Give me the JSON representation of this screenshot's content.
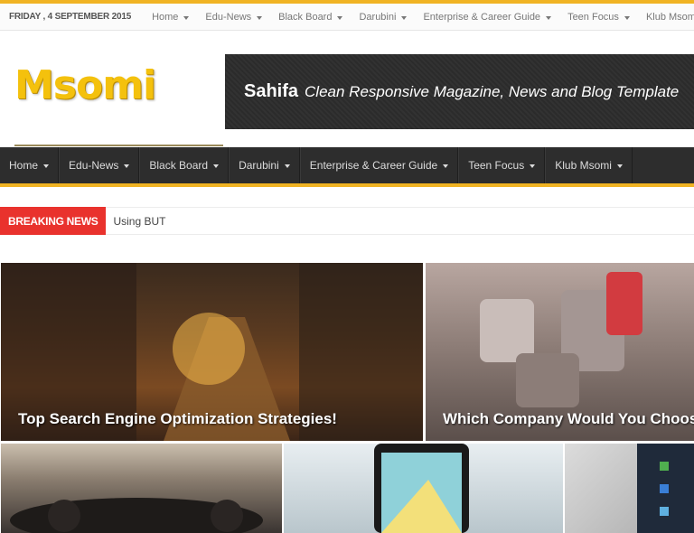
{
  "topbar": {
    "date": "FRIDAY , 4 SEPTEMBER 2015",
    "items": [
      "Home",
      "Edu-News",
      "Black Board",
      "Darubini",
      "Enterprise & Career Guide",
      "Teen Focus",
      "Klub Msomi"
    ]
  },
  "header": {
    "logo_text": "Msomi",
    "banner_name": "Sahifa",
    "banner_tagline": "Clean Responsive Magazine, News and Blog Template"
  },
  "mainnav": {
    "items": [
      "Home",
      "Edu-News",
      "Black Board",
      "Darubini",
      "Enterprise & Career Guide",
      "Teen Focus",
      "Klub Msomi"
    ]
  },
  "breaking": {
    "label": "BREAKING NEWS",
    "text": "Using BUT"
  },
  "slider": {
    "captions": [
      "Top Search Engine Optimization Strategies!",
      "Which Company Would You Choose?"
    ]
  },
  "colors": {
    "accent": "#f0b323",
    "breaking": "#e9322d",
    "nav_bg": "#2d2d2d"
  }
}
